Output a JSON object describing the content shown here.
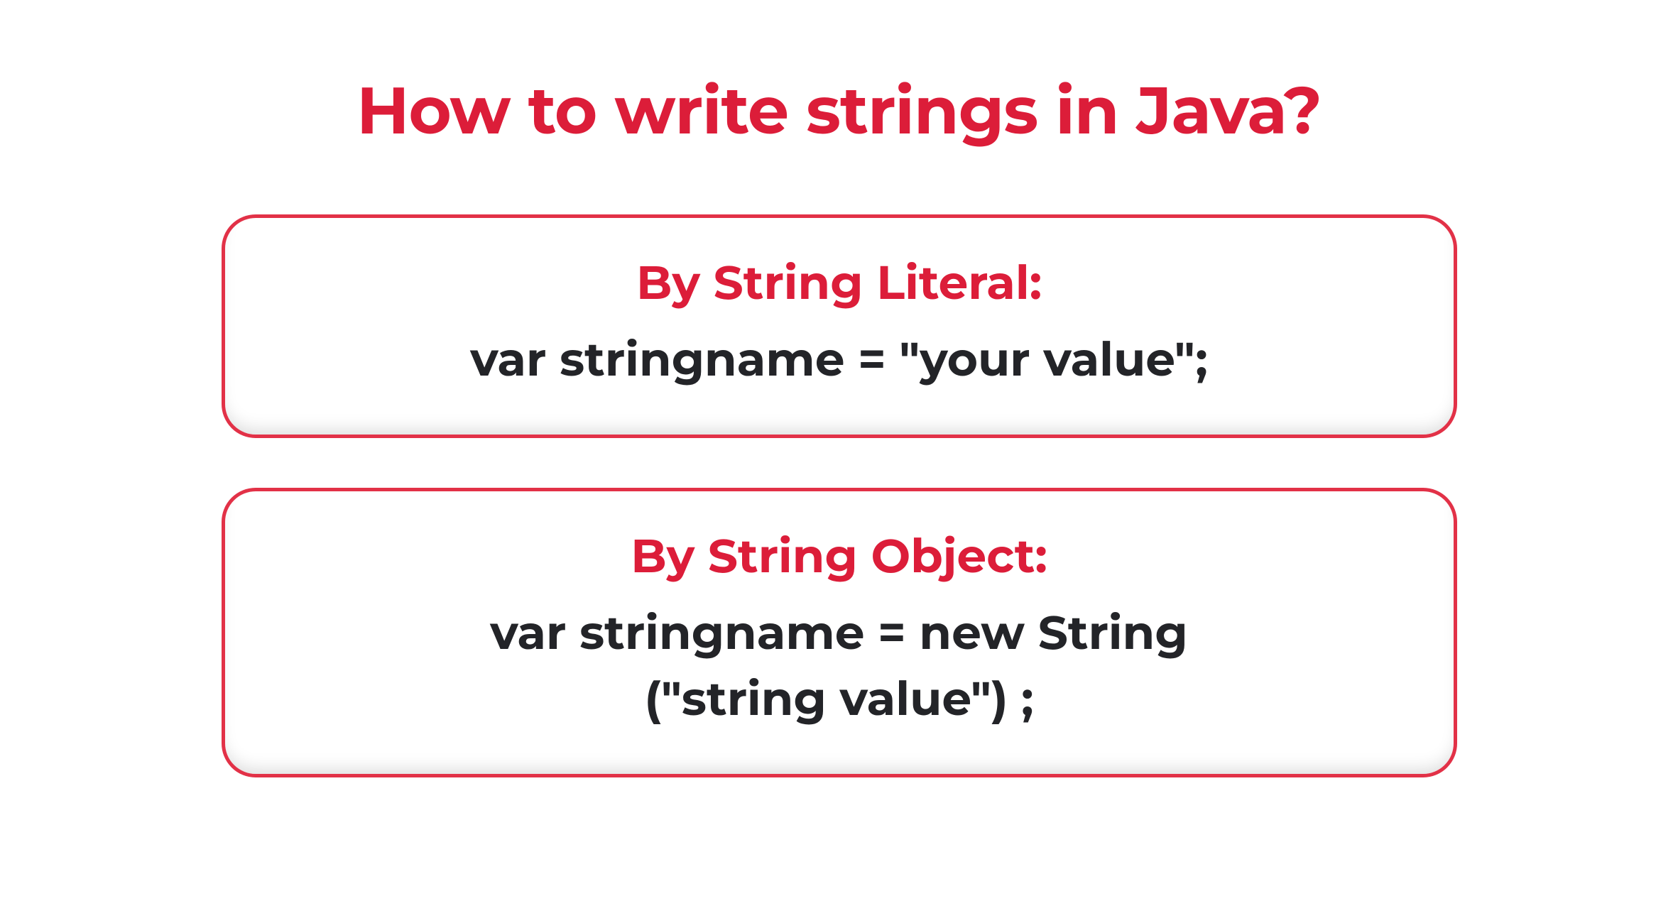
{
  "title": "How to write strings in Java?",
  "methods": [
    {
      "heading": "By String Literal:",
      "code_lines": [
        "var stringname = \"your value\";"
      ]
    },
    {
      "heading": "By String Object:",
      "code_lines": [
        "var stringname = new String",
        "(\"string value\") ;"
      ]
    }
  ],
  "colors": {
    "accent": "#dc1d39",
    "text": "#232428",
    "border": "#e23147"
  }
}
